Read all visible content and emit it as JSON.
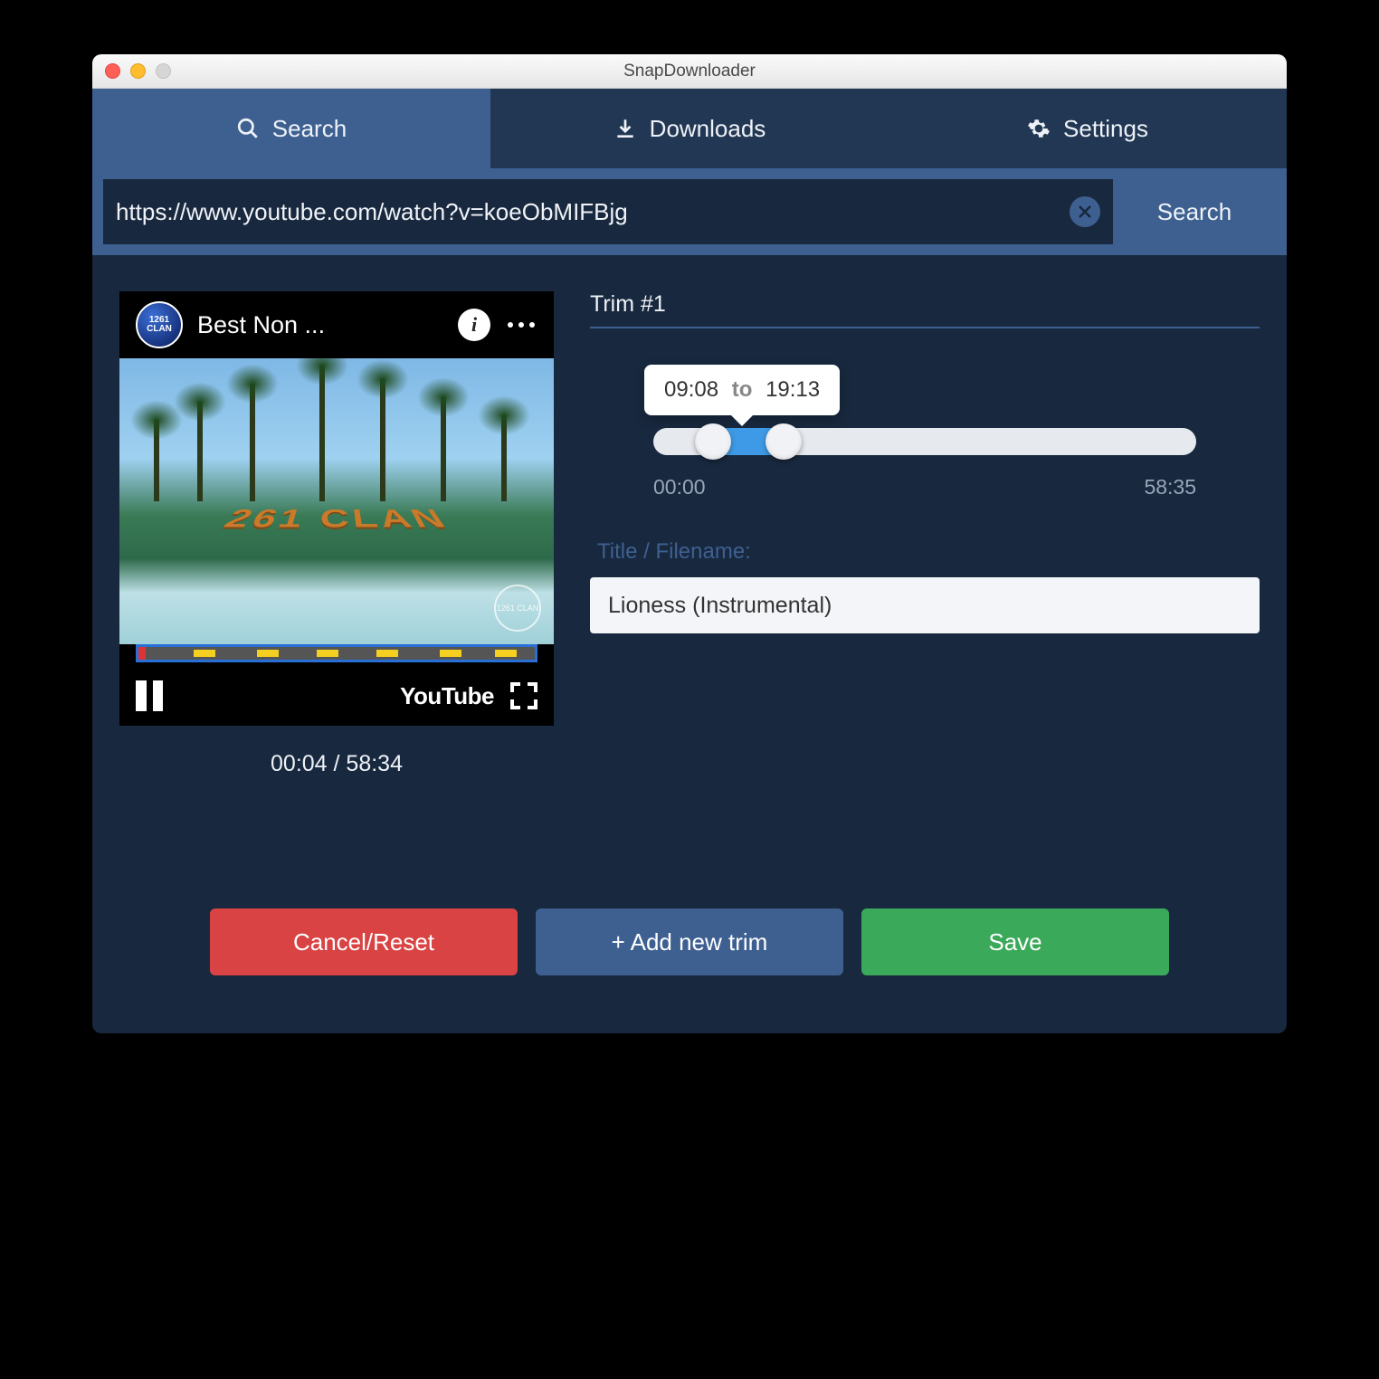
{
  "window": {
    "title": "SnapDownloader"
  },
  "tabs": {
    "search": "Search",
    "downloads": "Downloads",
    "settings": "Settings",
    "active": "search"
  },
  "search": {
    "url": "https://www.youtube.com/watch?v=koeObMIFBjg",
    "button": "Search"
  },
  "preview": {
    "channel_badge": "1261\nCLAN",
    "video_title": "Best Non ...",
    "sand_text": "261 CLAN",
    "watermark": "1261\nCLAN",
    "youtube_logo": "YouTube",
    "position": "00:04",
    "duration": "58:34",
    "time_display": "00:04 / 58:34"
  },
  "trim": {
    "header": "Trim #1",
    "range_start": "09:08",
    "range_to_word": "to",
    "range_end": "19:13",
    "track_min": "00:00",
    "track_max": "58:35",
    "filename_label": "Title / Filename:",
    "filename_value": "Lioness (Instrumental)"
  },
  "buttons": {
    "cancel": "Cancel/Reset",
    "add_trim": "+ Add new trim",
    "save": "Save"
  }
}
